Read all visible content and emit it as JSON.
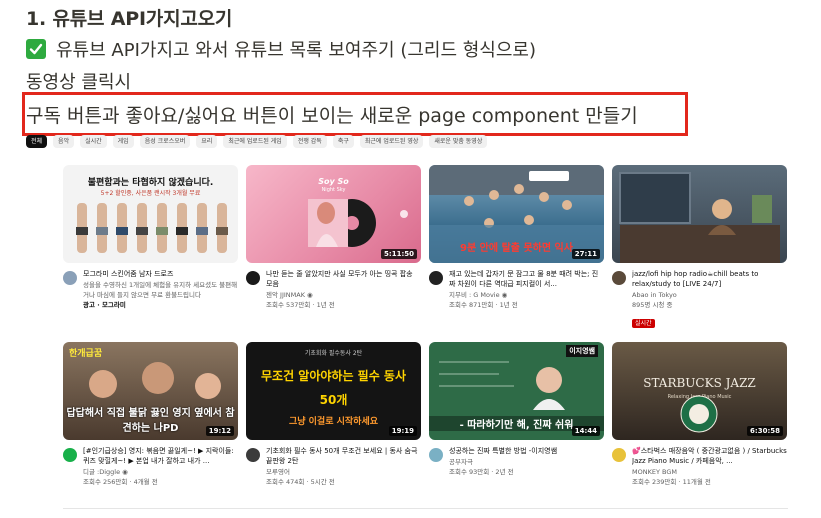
{
  "doc": {
    "heading": "1. 유튜브 API가지고오기",
    "todo_text": "유튜브 API가지고 와서 유튜브 목록 보여주기 (그리드 형식으로)",
    "line3": "동영상 클릭시",
    "callout_text": "구독 버튼과 좋아요/싫어요 버튼이 보이는 새로운 page component 만들기"
  },
  "colors": {
    "callout_border": "#e2281c",
    "checkbox": "#2eaa3f",
    "live_badge": "#cc0000"
  },
  "videos": [
    {
      "thumb_text": "불편함과는 타협하지 않겠습니다.",
      "thumb_sub": "5+2 할인중, 사은품 랜시작 3개월 무료",
      "title": "모그라미 스킨어줌 남자 드로즈",
      "channel": "성을을 수영하신 1개일에 체험을 유지하 세요셨도 불편해거나 마심에 들지 않으면 무료 환불드립니다",
      "stats": "",
      "extra": "광고 · 모그라미",
      "avatar_color": "#8aa0b8"
    },
    {
      "thumb_text": "Soy So",
      "thumb_sub": "Night Sky",
      "duration": "5:11:50",
      "title": "나만 듣는 줄 알았지만 사실 모두가 아는 띵곡 팝송 모음",
      "channel": "젠악 JJINMAK ◉",
      "stats": "조회수 537만회 · 1년 전",
      "avatar_color": "#1a1a1a"
    },
    {
      "thumb_text": "9분 안에 탈출 못하면 익사",
      "duration": "27:11",
      "title": "재고 있는데 갑자기 문 잠그고 물 8분 때려 박는; 진짜 차원이 다른 역대급 피지컬이 서...",
      "channel": "지무비 : G Movie ◉",
      "stats": "조회수 871만회 · 1년 전",
      "avatar_color": "#222222"
    },
    {
      "title": "jazz/lofi hip hop radio☕chill beats to relax/study to [LIVE 24/7]",
      "channel": "Abao in Tokyo",
      "stats": "895명 시청 중",
      "live": "실시간",
      "avatar_color": "#5a4a3a"
    },
    {
      "thumb_text": "답답해서 직접 불닭 끓인 영지 옆에서 참견하는 나PD",
      "thumb_top": "한개급꿈",
      "duration": "19:12",
      "title": "[#인기급상승] 영지: 볶음면 끓일게~! ▶ 지락이들: 퀴즈 맞힐게~! ▶ 본업 내가 잘하고 내가 ...",
      "channel": "디글 :Diggle ◉",
      "stats": "조회수 256만회 · 4개월 전",
      "avatar_color": "#18b04a"
    },
    {
      "thumb_text": "무조건 알아야하는 필수 동사 50개",
      "thumb_sub": "그냥 이걸로 시작하세요",
      "thumb_top": "기초회화 필수동사 2탄",
      "duration": "19:19",
      "title": "기초회화 필수 동사 50개 무조건 보세요 | 동사 숨극 끝판왕 2탄",
      "channel": "모루영어",
      "stats": "조회수 474회 · 5시간 전",
      "avatar_color": "#3b3b3b"
    },
    {
      "thumb_text": "- 따라하기만 해, 진짜 쉬워",
      "thumb_top": "이지영쌤",
      "duration": "14:44",
      "title": "성공하는 진짜 특별한 방법 -이지영쌤",
      "channel": "공부자극",
      "stats": "조회수 93만회 · 2년 전",
      "avatar_color": "#7ab0c4"
    },
    {
      "thumb_text": "STARBUCKS JAZZ",
      "thumb_sub": "Relaxing Jazz Piano Music",
      "duration": "6:30:58",
      "title": "💕스타벅스 매장음악 ( 중간광고없음 ) / Starbucks Jazz Piano Music / 카페음악, ...",
      "channel": "MONKEY BGM",
      "stats": "조회수 239만회 · 11개월 전",
      "avatar_color": "#e8c23a"
    }
  ],
  "chips": [
    "전체",
    "음악",
    "실시간",
    "게임",
    "음성 크로스오버",
    "요리",
    "최근에 업로드된 게임",
    "전쟁 감독",
    "축구",
    "최근에 업로드된 영상",
    "새로운 맞춤 동영상"
  ]
}
